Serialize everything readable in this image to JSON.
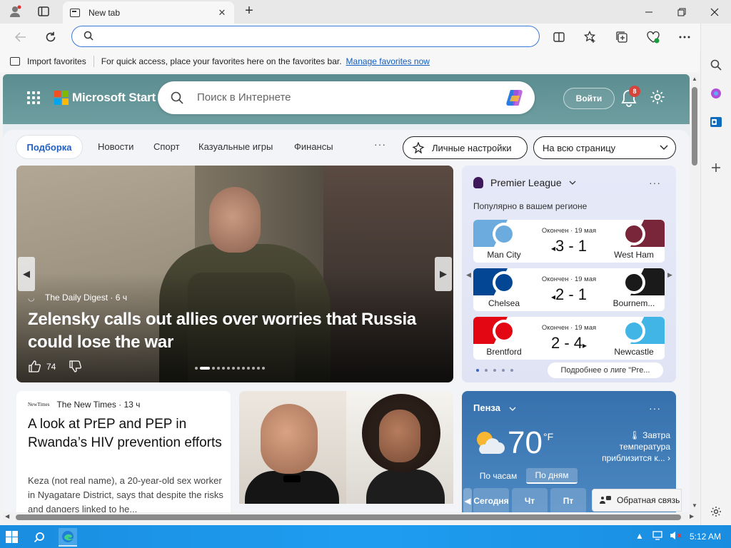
{
  "browser": {
    "tab_title": "New tab",
    "tab_close": "✕",
    "new_tab": "+",
    "omnibox": {
      "value": "",
      "placeholder": ""
    },
    "favorites_bar": {
      "import_label": "Import favorites",
      "hint": "For quick access, place your favorites here on the favorites bar.",
      "manage_link": "Manage favorites now"
    }
  },
  "header": {
    "brand": "Microsoft Start",
    "search_placeholder": "Поиск в Интернете",
    "signin": "Войти",
    "notifications_count": "8"
  },
  "nav": {
    "active": "Подборка",
    "items": [
      "Новости",
      "Спорт",
      "Казуальные игры",
      "Финансы"
    ],
    "more": "···",
    "personalize": "Личные настройки",
    "layout_select": "На всю страницу"
  },
  "hero": {
    "source": "The Daily Digest · 6 ч",
    "title": "Zelensky calls out allies over worries that Russia could lose the war",
    "likes": "74"
  },
  "sports": {
    "league": "Premier League",
    "more": "···",
    "subtitle": "Популярно в вашем регионе",
    "matches": [
      {
        "status": "Окончен · 19 мая",
        "home": "Man City",
        "away": "West Ham",
        "score": "3 - 1",
        "home_color": "#6cabdd",
        "away_color": "#7a263a",
        "winner": "home"
      },
      {
        "status": "Окончен · 19 мая",
        "home": "Chelsea",
        "away": "Bournem...",
        "score": "2 - 1",
        "home_color": "#034694",
        "away_color": "#1a1a1a",
        "winner": "home"
      },
      {
        "status": "Окончен · 19 мая",
        "home": "Brentford",
        "away": "Newcastle",
        "score": "2 - 4",
        "home_color": "#e30613",
        "away_color": "#41b6e6",
        "winner": "away"
      }
    ],
    "link": "Подробнее о лиге \"Pre..."
  },
  "article": {
    "source": "The New Times · 13 ч",
    "source_logo": "NewTimes",
    "title": "A look at PrEP and PEP in Rwanda’s HIV prevention efforts",
    "body": "Keza (not real name), a 20-year-old sex worker in Nyagatare District, says that despite the risks and dangers linked to he..."
  },
  "weather": {
    "city": "Пенза",
    "more": "···",
    "temp": "70",
    "unit": "°F",
    "alert": "Завтра температура приблизится к...",
    "tabs": [
      "По часам",
      "По дням"
    ],
    "days": [
      "Сегодня",
      "Чт",
      "Пт"
    ]
  },
  "feedback": "Обратная связь",
  "taskbar": {
    "time": "5:12 AM"
  }
}
